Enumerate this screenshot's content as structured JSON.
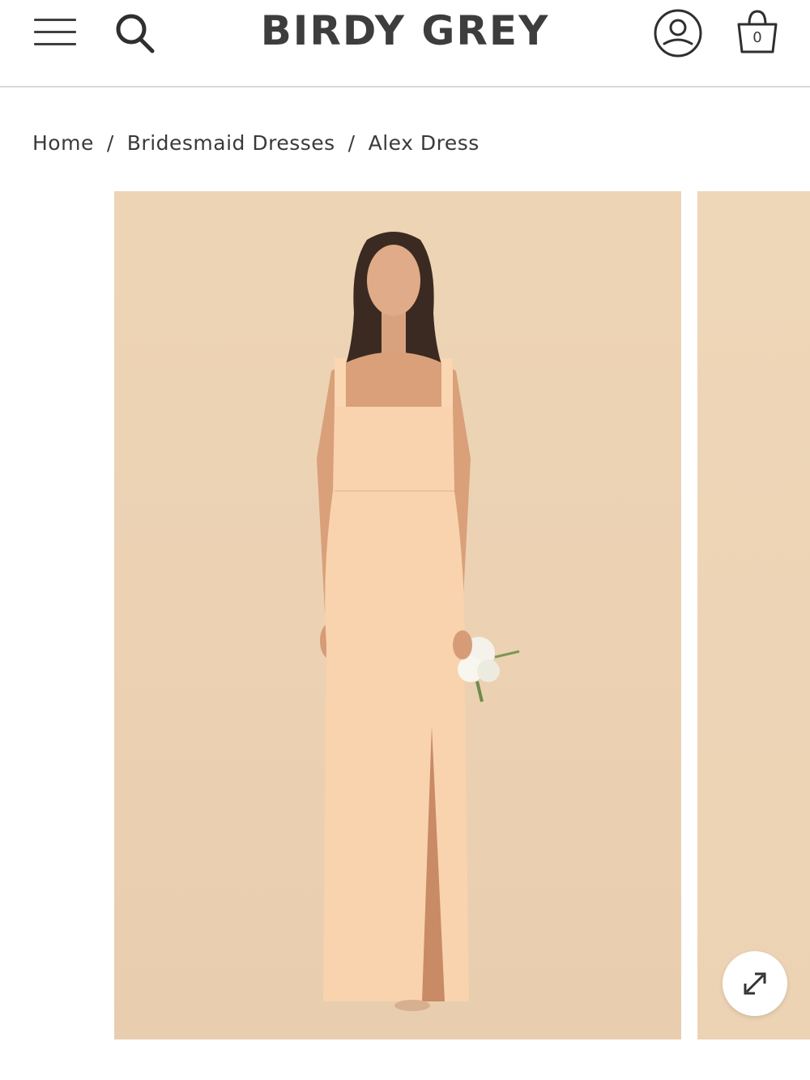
{
  "header": {
    "logo": "BIRDY GREY",
    "menu_icon": "hamburger-menu-icon",
    "search_icon": "search-icon",
    "account_icon": "user-account-icon",
    "cart_icon": "shopping-bag-icon",
    "cart_count": "0"
  },
  "breadcrumb": {
    "items": [
      {
        "label": "Home"
      },
      {
        "label": "Bridesmaid Dresses"
      },
      {
        "label": "Alex Dress"
      }
    ],
    "separator": "/"
  },
  "gallery": {
    "expand_icon": "expand-arrows-icon"
  },
  "colors": {
    "background_beige": "#ecd2b3",
    "dress_peach": "#f7cfa6",
    "logo_text": "#3d3d3d"
  }
}
